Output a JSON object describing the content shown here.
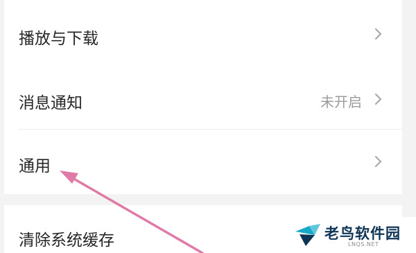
{
  "settings": {
    "items": [
      {
        "label": "播放与下载",
        "value": "",
        "icon": "chevron-right-icon"
      },
      {
        "label": "消息通知",
        "value": "未开启",
        "icon": "chevron-right-icon"
      },
      {
        "label": "通用",
        "value": "",
        "icon": "chevron-right-icon"
      }
    ],
    "clear_cache": {
      "label": "清除系统缓存"
    }
  },
  "annotation": {
    "arrow_icon": "pink-arrow-icon",
    "color": "#e07aa6"
  },
  "watermark": {
    "name": "老鸟软件园",
    "url": "LNQS.NET",
    "logo_icon": "bird-logo-icon",
    "brand_color": "#0f3556",
    "accent_color": "#1aa8c9"
  }
}
